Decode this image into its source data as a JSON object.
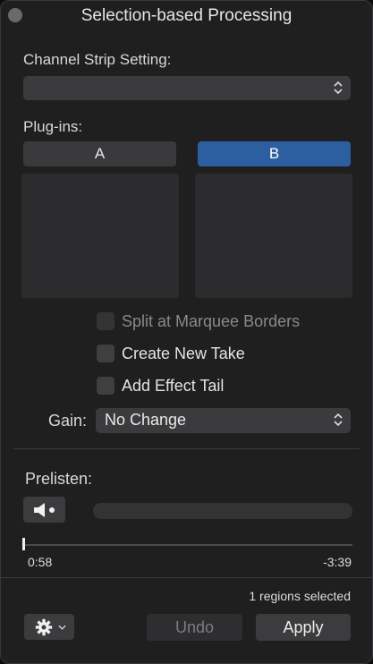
{
  "window": {
    "title": "Selection-based Processing"
  },
  "channel_strip": {
    "label": "Channel Strip Setting:",
    "value": ""
  },
  "plugins": {
    "label": "Plug-ins:",
    "tabs": [
      {
        "label": "A",
        "active": false
      },
      {
        "label": "B",
        "active": true
      }
    ]
  },
  "options": {
    "split": {
      "label": "Split at Marquee Borders",
      "checked": false,
      "enabled": false
    },
    "new_take": {
      "label": "Create New Take",
      "checked": false,
      "enabled": true
    },
    "effect_tail": {
      "label": "Add Effect Tail",
      "checked": false,
      "enabled": true
    }
  },
  "gain": {
    "label": "Gain:",
    "value": "No Change"
  },
  "prelisten": {
    "label": "Prelisten:",
    "progress": 0.0
  },
  "timeline": {
    "start": "0:58",
    "end": "-3:39"
  },
  "status": {
    "text": "1 regions selected"
  },
  "footer": {
    "undo_label": "Undo",
    "apply_label": "Apply",
    "gear_icon": "gear-icon"
  },
  "colors": {
    "accent": "#2c5fa0",
    "background": "#1f1f20"
  }
}
